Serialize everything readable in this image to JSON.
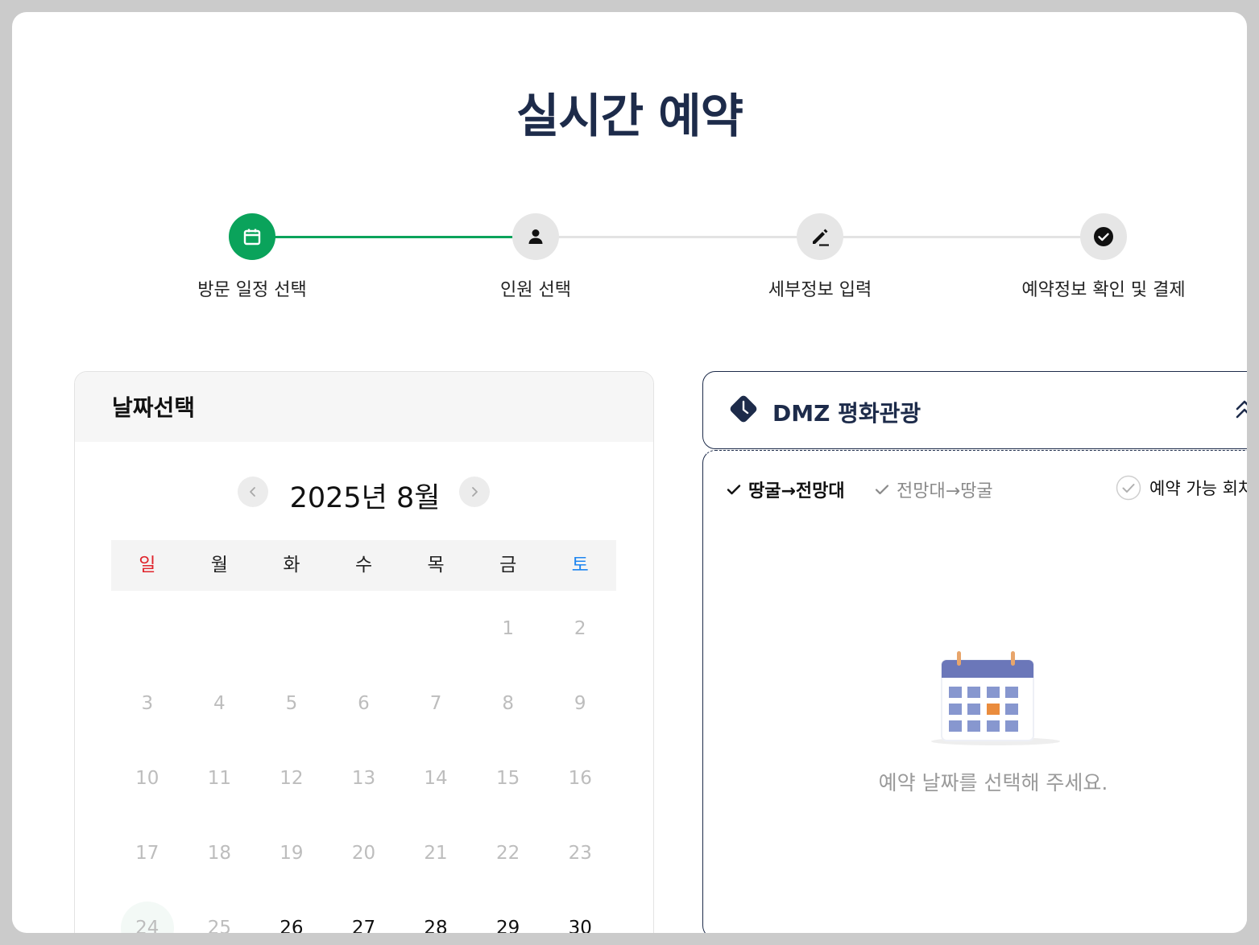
{
  "title": "실시간 예약",
  "steps": [
    {
      "label": "방문 일정 선택",
      "icon": "calendar-icon",
      "active": true
    },
    {
      "label": "인원 선택",
      "icon": "person-icon",
      "active": false
    },
    {
      "label": "세부정보 입력",
      "icon": "pencil-icon",
      "active": false
    },
    {
      "label": "예약정보 확인 및 결제",
      "icon": "check-circle-icon",
      "active": false
    }
  ],
  "colors": {
    "accent": "#0aa35b",
    "navy": "#1d2b4a",
    "sunday": "#e0242c",
    "saturday": "#1f86f0"
  },
  "calendar": {
    "header": "날짜선택",
    "month_label": "2025년 8월",
    "weekdays": [
      "일",
      "월",
      "화",
      "수",
      "목",
      "금",
      "토"
    ],
    "days": [
      {
        "d": "",
        "s": "empty"
      },
      {
        "d": "",
        "s": "empty"
      },
      {
        "d": "",
        "s": "empty"
      },
      {
        "d": "",
        "s": "empty"
      },
      {
        "d": "",
        "s": "empty"
      },
      {
        "d": "1",
        "s": "disabled"
      },
      {
        "d": "2",
        "s": "disabled"
      },
      {
        "d": "3",
        "s": "disabled"
      },
      {
        "d": "4",
        "s": "disabled"
      },
      {
        "d": "5",
        "s": "disabled"
      },
      {
        "d": "6",
        "s": "disabled"
      },
      {
        "d": "7",
        "s": "disabled"
      },
      {
        "d": "8",
        "s": "disabled"
      },
      {
        "d": "9",
        "s": "disabled"
      },
      {
        "d": "10",
        "s": "disabled"
      },
      {
        "d": "11",
        "s": "disabled"
      },
      {
        "d": "12",
        "s": "disabled"
      },
      {
        "d": "13",
        "s": "disabled"
      },
      {
        "d": "14",
        "s": "disabled"
      },
      {
        "d": "15",
        "s": "disabled"
      },
      {
        "d": "16",
        "s": "disabled"
      },
      {
        "d": "17",
        "s": "disabled"
      },
      {
        "d": "18",
        "s": "disabled"
      },
      {
        "d": "19",
        "s": "disabled"
      },
      {
        "d": "20",
        "s": "disabled"
      },
      {
        "d": "21",
        "s": "disabled"
      },
      {
        "d": "22",
        "s": "disabled"
      },
      {
        "d": "23",
        "s": "disabled"
      },
      {
        "d": "24",
        "s": "today"
      },
      {
        "d": "25",
        "s": "disabled"
      },
      {
        "d": "26",
        "s": "available"
      },
      {
        "d": "27",
        "s": "available"
      },
      {
        "d": "28",
        "s": "available"
      },
      {
        "d": "29",
        "s": "available"
      },
      {
        "d": "30",
        "s": "available"
      }
    ]
  },
  "tour": {
    "title": "DMZ 평화관광",
    "routes": [
      {
        "label": "땅굴→전망대",
        "active": true
      },
      {
        "label": "전망대→땅굴",
        "active": false
      }
    ],
    "legend": "예약 가능 회차",
    "empty_message": "예약 날짜를 선택해 주세요."
  }
}
